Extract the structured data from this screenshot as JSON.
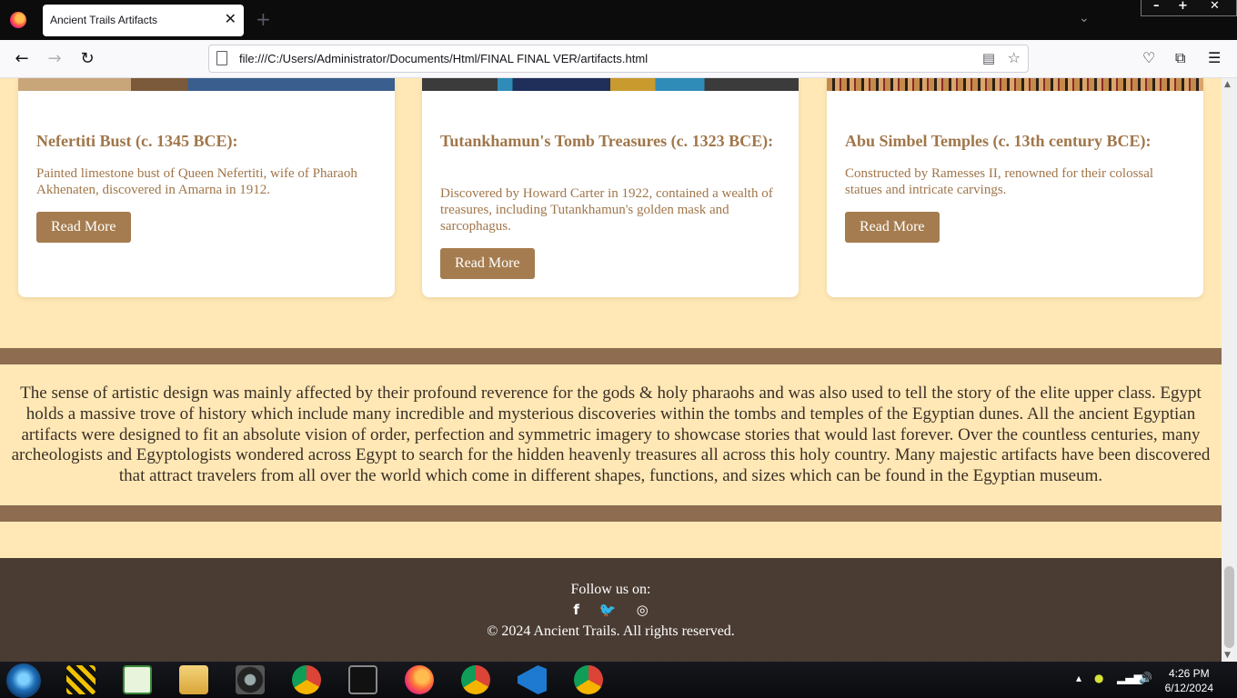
{
  "browser": {
    "tab_title": "Ancient Trails Artifacts",
    "tab_close": "✕",
    "new_tab": "+",
    "url": "file:///C:/Users/Administrator/Documents/Html/FINAL FINAL VER/artifacts.html",
    "window_controls": {
      "minimize": "–",
      "maximize": "+",
      "close": "✕"
    }
  },
  "cards": [
    {
      "title": "Nefertiti Bust (c. 1345 BCE):",
      "description": "Painted limestone bust of Queen Nefertiti, wife of Pharaoh Akhenaten, discovered in Amarna in 1912.",
      "button": "Read More"
    },
    {
      "title": "Tutankhamun's Tomb Treasures (c. 1323 BCE):",
      "description": "Discovered by Howard Carter in 1922, contained a wealth of treasures, including Tutankhamun's golden mask and sarcophagus.",
      "button": "Read More"
    },
    {
      "title": "Abu Simbel Temples (c. 13th century BCE):",
      "description": "Constructed by Ramesses II, renowned for their colossal statues and intricate carvings.",
      "button": "Read More"
    }
  ],
  "about_text": "The sense of artistic design was mainly affected by their profound reverence for the gods & holy pharaohs and was also used to tell the story of the elite upper class. Egypt holds a massive trove of history which include many incredible and mysterious discoveries within the tombs and temples of the Egyptian dunes. All the ancient Egyptian artifacts were designed to fit an absolute vision of order, perfection and symmetric imagery to showcase stories that would last forever. Over the countless centuries, many archeologists and Egyptologists wondered across Egypt to search for the hidden heavenly treasures all across this holy country. Many majestic artifacts have been discovered that attract travelers from all over the world which come in different shapes, functions, and sizes which can be found in the Egyptian museum.",
  "footer": {
    "follow": "Follow us on:",
    "socials": [
      "facebook-icon",
      "twitter-icon",
      "instagram-icon"
    ],
    "copyright": "© 2024 Ancient Trails. All rights reserved."
  },
  "taskbar": {
    "time": "4:26 PM",
    "date": "6/12/2024"
  },
  "colors": {
    "page_background": "#ffe8b5",
    "card_text": "#a0764a",
    "button": "#a57c4f",
    "band": "#8d6c50",
    "footer": "#4a3c33"
  }
}
